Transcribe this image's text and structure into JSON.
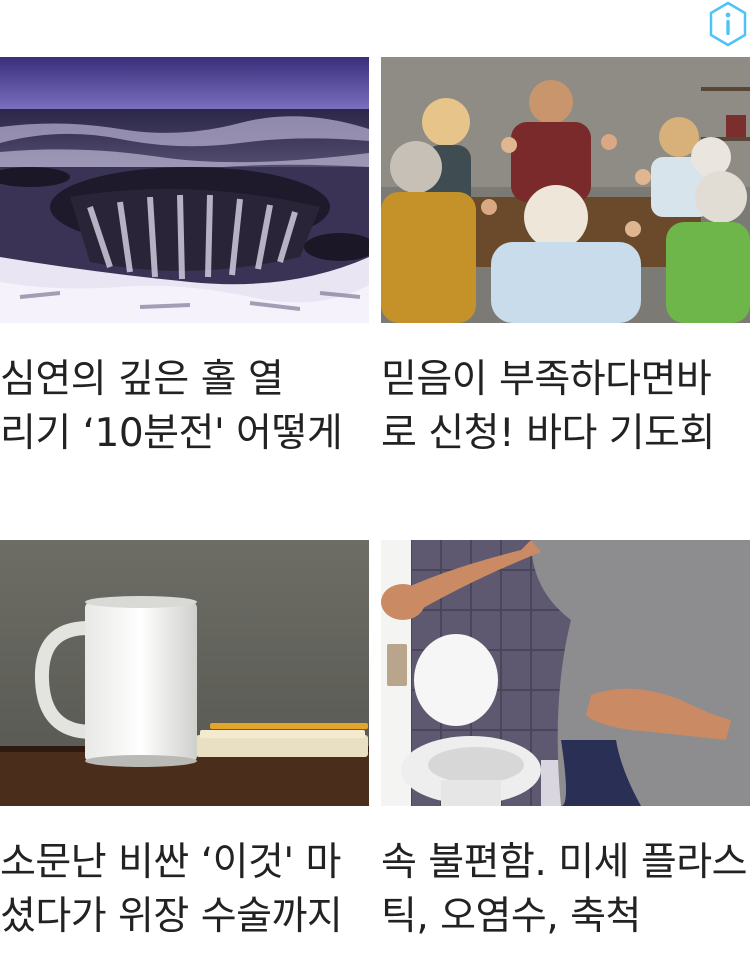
{
  "ad_info": {
    "icon": "info-hexagon-icon",
    "color": "#4fc3f7"
  },
  "cards": [
    {
      "image": "ocean-sinkhole-photo",
      "title": "심연의 깊은 홀 열\n리기 ‘10분전' 어떻게"
    },
    {
      "image": "family-prayer-dinner-photo",
      "title": "믿음이 부족하다면바\n로 신청! 바다 기도회"
    },
    {
      "image": "white-mug-on-table-photo",
      "title": "소문난 비싼 ‘이것' 마\n셨다가 위장 수술까지"
    },
    {
      "image": "stomach-ache-toilet-photo",
      "title": "속 불편함. 미세 플라스\n틱, 오염수, 축척"
    }
  ]
}
